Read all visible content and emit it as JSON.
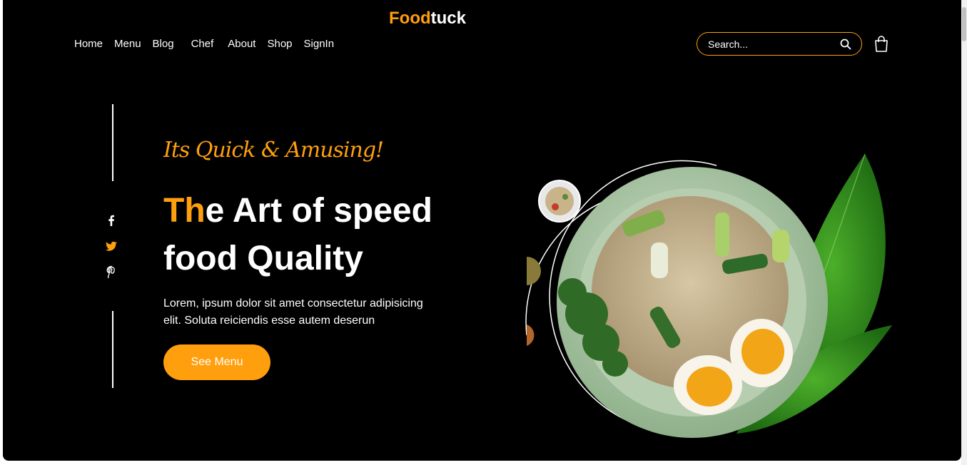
{
  "brand": {
    "part1": "Food",
    "part2": "tuck"
  },
  "nav": [
    "Home",
    "Menu",
    "Blog",
    "Chef",
    "About",
    "Shop",
    "SignIn"
  ],
  "search": {
    "placeholder": "Search..."
  },
  "social": [
    "facebook-icon",
    "twitter-icon",
    "pinterest-icon"
  ],
  "hero": {
    "tagline": "Its Quick & Amusing!",
    "headline_accent": "Th",
    "headline_rest_1": "e Art of speed",
    "headline_line2": "food Quality",
    "description": "Lorem, ipsum dolor sit amet consectetur adipisicing elit. Soluta reiciendis esse autem deserun",
    "cta": "See Menu"
  },
  "colors": {
    "accent": "#ff9f0d",
    "background": "#000000",
    "text": "#ffffff"
  }
}
